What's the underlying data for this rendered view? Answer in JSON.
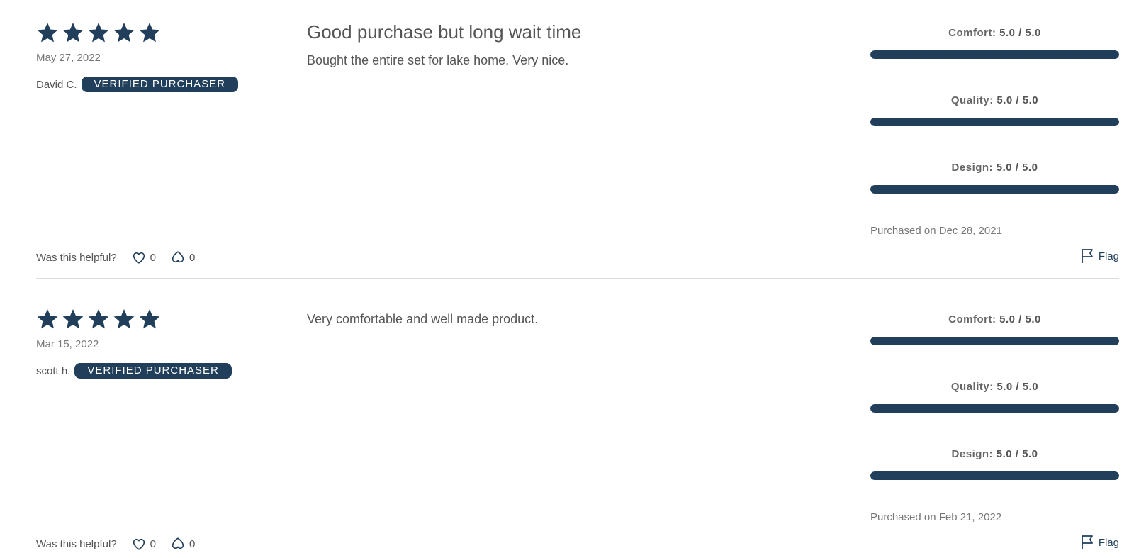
{
  "colors": {
    "accent": "#213f5b",
    "text": "#555555",
    "muted": "#777777",
    "divider": "#dcdcdc"
  },
  "reviews": [
    {
      "stars": 5,
      "date": "May 27, 2022",
      "author": "David C.",
      "badge": "VERIFIED PURCHASER",
      "title": "Good purchase but long wait time",
      "body": "Bought the entire set for lake home. Very nice.",
      "ratings": [
        {
          "label": "Comfort:",
          "value": "5.0 / 5.0",
          "fraction": 1.0
        },
        {
          "label": "Quality:",
          "value": "5.0 / 5.0",
          "fraction": 1.0
        },
        {
          "label": "Design:",
          "value": "5.0 / 5.0",
          "fraction": 1.0
        }
      ],
      "purchased": "Purchased on Dec 28, 2021",
      "helpful_label": "Was this helpful?",
      "upvotes": "0",
      "downvotes": "0",
      "flag_label": "Flag"
    },
    {
      "stars": 5,
      "date": "Mar 15, 2022",
      "author": "scott h.",
      "badge": "VERIFIED PURCHASER",
      "title": "",
      "body": "Very comfortable and well made product.",
      "ratings": [
        {
          "label": "Comfort:",
          "value": "5.0 / 5.0",
          "fraction": 1.0
        },
        {
          "label": "Quality:",
          "value": "5.0 / 5.0",
          "fraction": 1.0
        },
        {
          "label": "Design:",
          "value": "5.0 / 5.0",
          "fraction": 1.0
        }
      ],
      "purchased": "Purchased on Feb 21, 2022",
      "helpful_label": "Was this helpful?",
      "upvotes": "0",
      "downvotes": "0",
      "flag_label": "Flag"
    }
  ]
}
